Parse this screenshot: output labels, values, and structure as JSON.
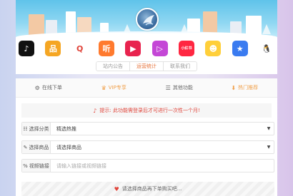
{
  "header": {
    "avatar_icon": "bird-avatar-icon"
  },
  "apps": [
    {
      "name": "tiktok-icon",
      "bg": "#111111",
      "glyph": "♪"
    },
    {
      "name": "quanmin-icon",
      "bg": "#f5a623",
      "glyph": "品"
    },
    {
      "name": "kuwo-icon",
      "bg": "#ffffff",
      "glyph": "Q"
    },
    {
      "name": "ting-icon",
      "bg": "#ff7a2e",
      "glyph": "听"
    },
    {
      "name": "video-play-icon",
      "bg": "#e8234e",
      "glyph": "▶"
    },
    {
      "name": "bilibili-like-icon",
      "bg": "#c447d6",
      "glyph": "▷"
    },
    {
      "name": "xiaohongshu-icon",
      "bg": "#ff2741",
      "glyph": "小红书"
    },
    {
      "name": "cartoon-face-icon",
      "bg": "#ffcf3a",
      "glyph": "☻"
    },
    {
      "name": "star-icon",
      "bg": "#3a7bf0",
      "glyph": "★"
    },
    {
      "name": "qq-penguin-icon",
      "bg": "#ffffff",
      "glyph": "🐧"
    }
  ],
  "segments": [
    {
      "label": "站内公告",
      "active": false
    },
    {
      "label": "运营统计",
      "active": true
    },
    {
      "label": "联系我们",
      "active": false
    }
  ],
  "tabs": [
    {
      "icon": "⚙",
      "label": "在线下单",
      "color": "normal"
    },
    {
      "icon": "♛",
      "label": "VIP专享",
      "color": "orange"
    },
    {
      "icon": "☰",
      "label": "其他功能",
      "color": "normal"
    },
    {
      "icon": "⬇",
      "label": "热门推荐",
      "color": "orange"
    }
  ],
  "notice": {
    "icon": "♪",
    "text": "提示: 此功能需登录后才可进行一次性一个月!"
  },
  "form": {
    "category": {
      "label": "选择分类",
      "icon": "☷",
      "value": "精选热推"
    },
    "product": {
      "label": "选择商品",
      "icon": "✎",
      "value": "请选择商品"
    },
    "link": {
      "label": "视频链接",
      "icon": "%",
      "placeholder": "请输入链接或视频链接"
    }
  },
  "submit": {
    "icon": "♥",
    "text": "请选择商品再下单购买吧..."
  }
}
